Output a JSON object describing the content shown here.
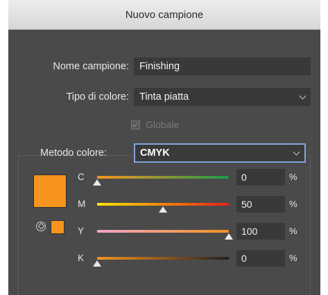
{
  "dialog": {
    "title": "Nuovo campione",
    "swatch_name_label": "Nome campione:",
    "swatch_name_value": "Finishing",
    "color_type_label": "Tipo di colore:",
    "color_type_value": "Tinta piatta",
    "global_label": "Globale",
    "global_checked": true,
    "global_disabled": true,
    "color_mode_label": "Metodo colore:",
    "color_mode_value": "CMYK"
  },
  "swatch_color": "#f7941e",
  "channels": [
    {
      "label": "C",
      "value": "0",
      "unit": "%",
      "level": 0.0,
      "gradient": [
        "#f7941e",
        "#1f9a4a"
      ]
    },
    {
      "label": "M",
      "value": "50",
      "unit": "%",
      "level": 0.5,
      "gradient": [
        "#ffe600",
        "#e2231a"
      ]
    },
    {
      "label": "Y",
      "value": "100",
      "unit": "%",
      "level": 1.0,
      "gradient": [
        "#f4a6c8",
        "#f7941e"
      ]
    },
    {
      "label": "K",
      "value": "0",
      "unit": "%",
      "level": 0.0,
      "gradient": [
        "#f7941e",
        "#231f20"
      ]
    }
  ]
}
